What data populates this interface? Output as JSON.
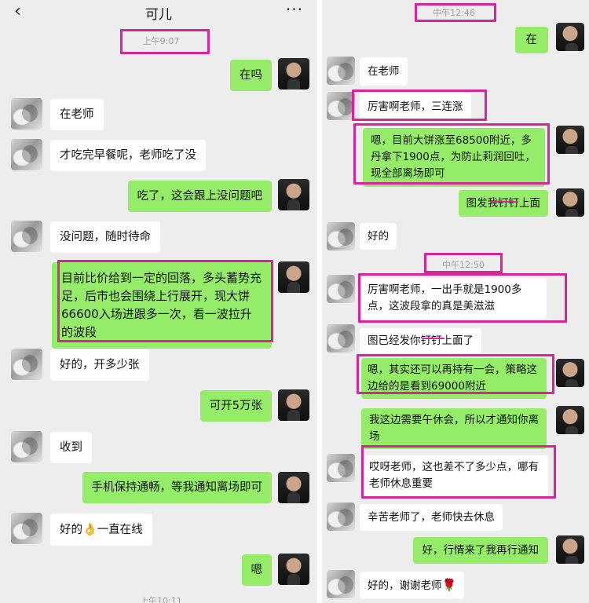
{
  "left": {
    "header": {
      "back_glyph": "‹",
      "title": "可儿",
      "more_glyph": "···"
    },
    "timestamp_top": "上午9:07",
    "messages": [
      {
        "text": "在吗"
      },
      {
        "text": "在老师"
      },
      {
        "text": "才吃完早餐呢，老师吃了没"
      },
      {
        "text": "吃了，这会跟上没问题吧"
      },
      {
        "text": "没问题，随时待命"
      },
      {
        "text": "目前比价给到一定的回落，多头蓄势充足，后市也会围绕上行展开，现大饼66600入场进跟多一次，看一波拉升的波段"
      },
      {
        "text": "好的，开多少张"
      },
      {
        "text": "可开5万张"
      },
      {
        "text": "收到"
      },
      {
        "text": "手机保持通畅，等我通知离场即可"
      },
      {
        "text_before": "好的",
        "emoji": "👌",
        "text_after": "一直在线"
      },
      {
        "text": "嗯"
      }
    ],
    "timestamp_bottom": "上午10:11"
  },
  "right": {
    "timestamp_1": "中午12:46",
    "timestamp_2": "中午12:50",
    "messages": [
      {
        "text": "在"
      },
      {
        "text": "在老师"
      },
      {
        "text": "厉害啊老师，三连涨"
      },
      {
        "text": "嗯，目前大饼涨至68500附近，多丹拿下1900点，为防止莉润回吐，现全部离场即可"
      },
      {
        "text": "图发我钉钉上面"
      },
      {
        "text": "好的"
      },
      {
        "text": "厉害啊老师，一出手就是1900多点，这波段拿的真是美滋滋"
      },
      {
        "text": "图已经发你钉钉上面了"
      },
      {
        "text": "嗯，其实还可以再持有一会，策略这边给的是看到69000附近"
      },
      {
        "text": "我这边需要午休会，所以才通知你离场"
      },
      {
        "text": "哎呀老师，这也差不了多少点，哪有老师休息重要"
      },
      {
        "text": "辛苦老师了，老师快去休息"
      },
      {
        "text": "好，行情来了我再行通知"
      },
      {
        "text_before": "好的，谢谢老师",
        "emoji": "🌹"
      }
    ]
  },
  "colors": {
    "background": "#ededed",
    "bubble_sent": "#95ec69",
    "bubble_received": "#ffffff",
    "highlight": "#d6249a",
    "timestamp": "#a0a0a0"
  },
  "icons": [
    "back-icon",
    "more-icon"
  ]
}
